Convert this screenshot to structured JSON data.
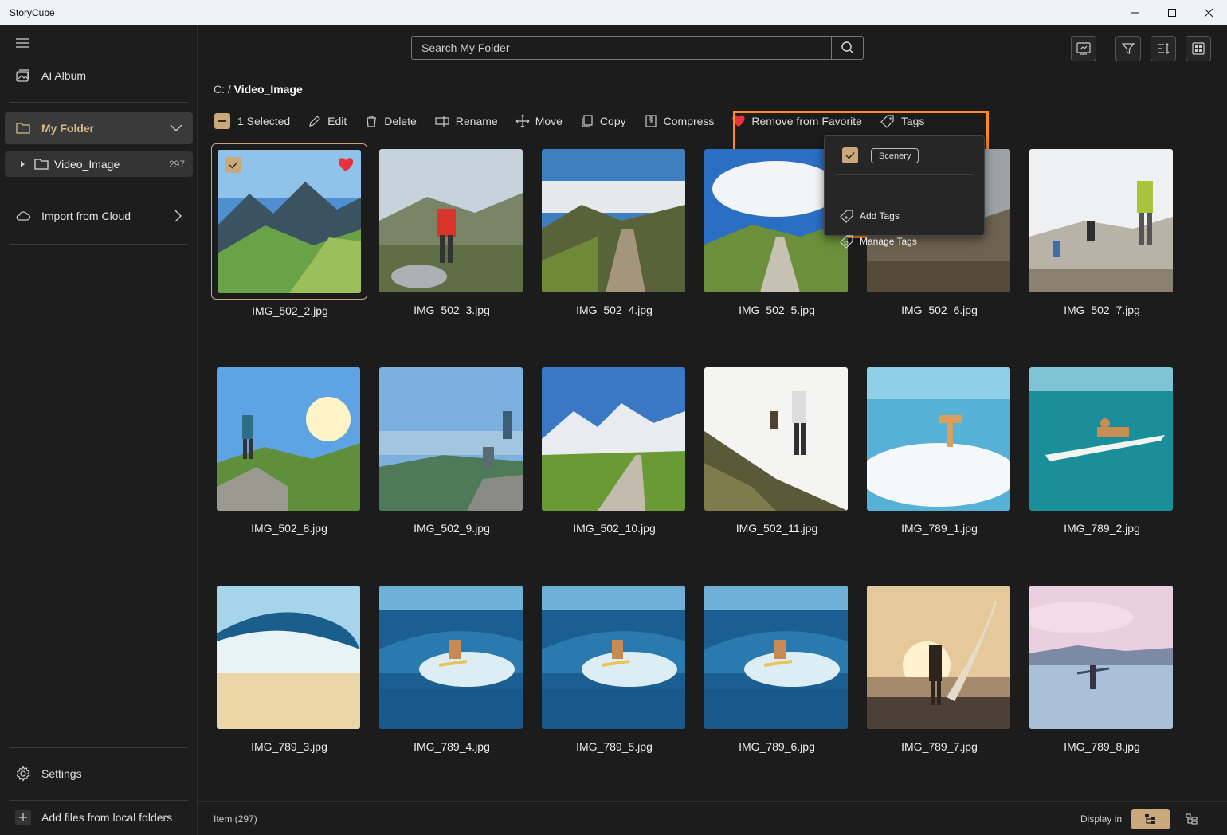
{
  "window": {
    "title": "StoryCube"
  },
  "sidebar": {
    "ai_album": "AI Album",
    "my_folder": "My Folder",
    "tree": {
      "label": "Video_Image",
      "count": "297"
    },
    "import_cloud": "Import from Cloud",
    "settings": "Settings",
    "add_files": "Add files from local folders"
  },
  "search": {
    "placeholder": "Search My Folder"
  },
  "breadcrumb": {
    "root": "C:",
    "separator": "/",
    "current": "Video_Image"
  },
  "actions": {
    "selected": "1 Selected",
    "edit": "Edit",
    "delete": "Delete",
    "rename": "Rename",
    "move": "Move",
    "copy": "Copy",
    "compress": "Compress",
    "remove_favorite": "Remove from Favorite",
    "tags": "Tags"
  },
  "tags_popup": {
    "tag_chip": "Scenery",
    "add_tags": "Add Tags",
    "manage_tags": "Manage Tags"
  },
  "files": [
    {
      "name": "IMG_502_2.jpg",
      "selected": true,
      "favorite": true,
      "scene": "mountain"
    },
    {
      "name": "IMG_502_3.jpg",
      "scene": "hiker-red"
    },
    {
      "name": "IMG_502_4.jpg",
      "scene": "ridge-path"
    },
    {
      "name": "IMG_502_5.jpg",
      "scene": "road-sky"
    },
    {
      "name": "IMG_502_6.jpg",
      "scene": "rocky"
    },
    {
      "name": "IMG_502_7.jpg",
      "scene": "hikers"
    },
    {
      "name": "IMG_502_8.jpg",
      "scene": "summit-man"
    },
    {
      "name": "IMG_502_9.jpg",
      "scene": "couple-view"
    },
    {
      "name": "IMG_502_10.jpg",
      "scene": "snow-path"
    },
    {
      "name": "IMG_502_11.jpg",
      "scene": "climb"
    },
    {
      "name": "IMG_789_1.jpg",
      "scene": "surf-splash"
    },
    {
      "name": "IMG_789_2.jpg",
      "scene": "surf-board"
    },
    {
      "name": "IMG_789_3.jpg",
      "scene": "wave-beach"
    },
    {
      "name": "IMG_789_4.jpg",
      "scene": "surf-wave"
    },
    {
      "name": "IMG_789_5.jpg",
      "scene": "surf-wave"
    },
    {
      "name": "IMG_789_6.jpg",
      "scene": "surf-wave"
    },
    {
      "name": "IMG_789_7.jpg",
      "scene": "sunset-surfer"
    },
    {
      "name": "IMG_789_8.jpg",
      "scene": "pastel-beach"
    }
  ],
  "status": {
    "item_count": "Item (297)",
    "display_in": "Display in"
  },
  "colors": {
    "accent": "#c9a97c",
    "highlight": "#ff8c1a",
    "favorite": "#e5323c"
  }
}
